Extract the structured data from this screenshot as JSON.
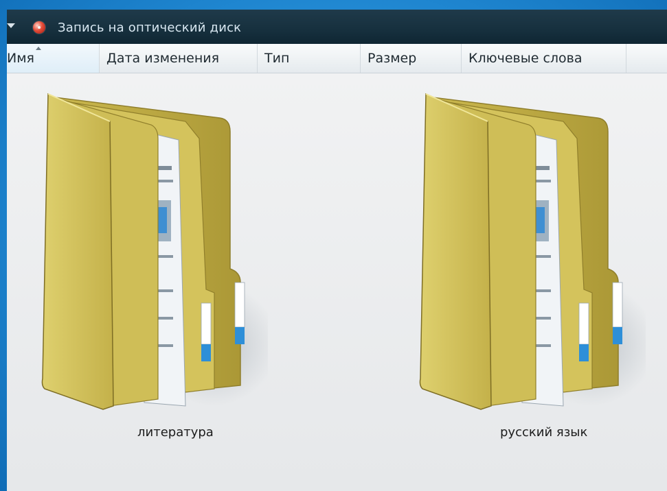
{
  "window": {
    "title": "Запись на оптический диск",
    "title_icon": "optical-disc-burn-icon"
  },
  "columns": [
    {
      "label": "Имя",
      "sorted": "ascending"
    },
    {
      "label": "Дата изменения"
    },
    {
      "label": "Тип"
    },
    {
      "label": "Размер"
    },
    {
      "label": "Ключевые слова"
    }
  ],
  "files": [
    {
      "name": "литература",
      "icon": "folder-icon"
    },
    {
      "name": "русский язык",
      "icon": "folder-icon"
    }
  ],
  "colors": {
    "folder": "#d8c65c",
    "folder_dark": "#b3a03a",
    "paper": "#eef2f6",
    "accent": "#2e8fd8",
    "desktop": "#1f86d0"
  }
}
